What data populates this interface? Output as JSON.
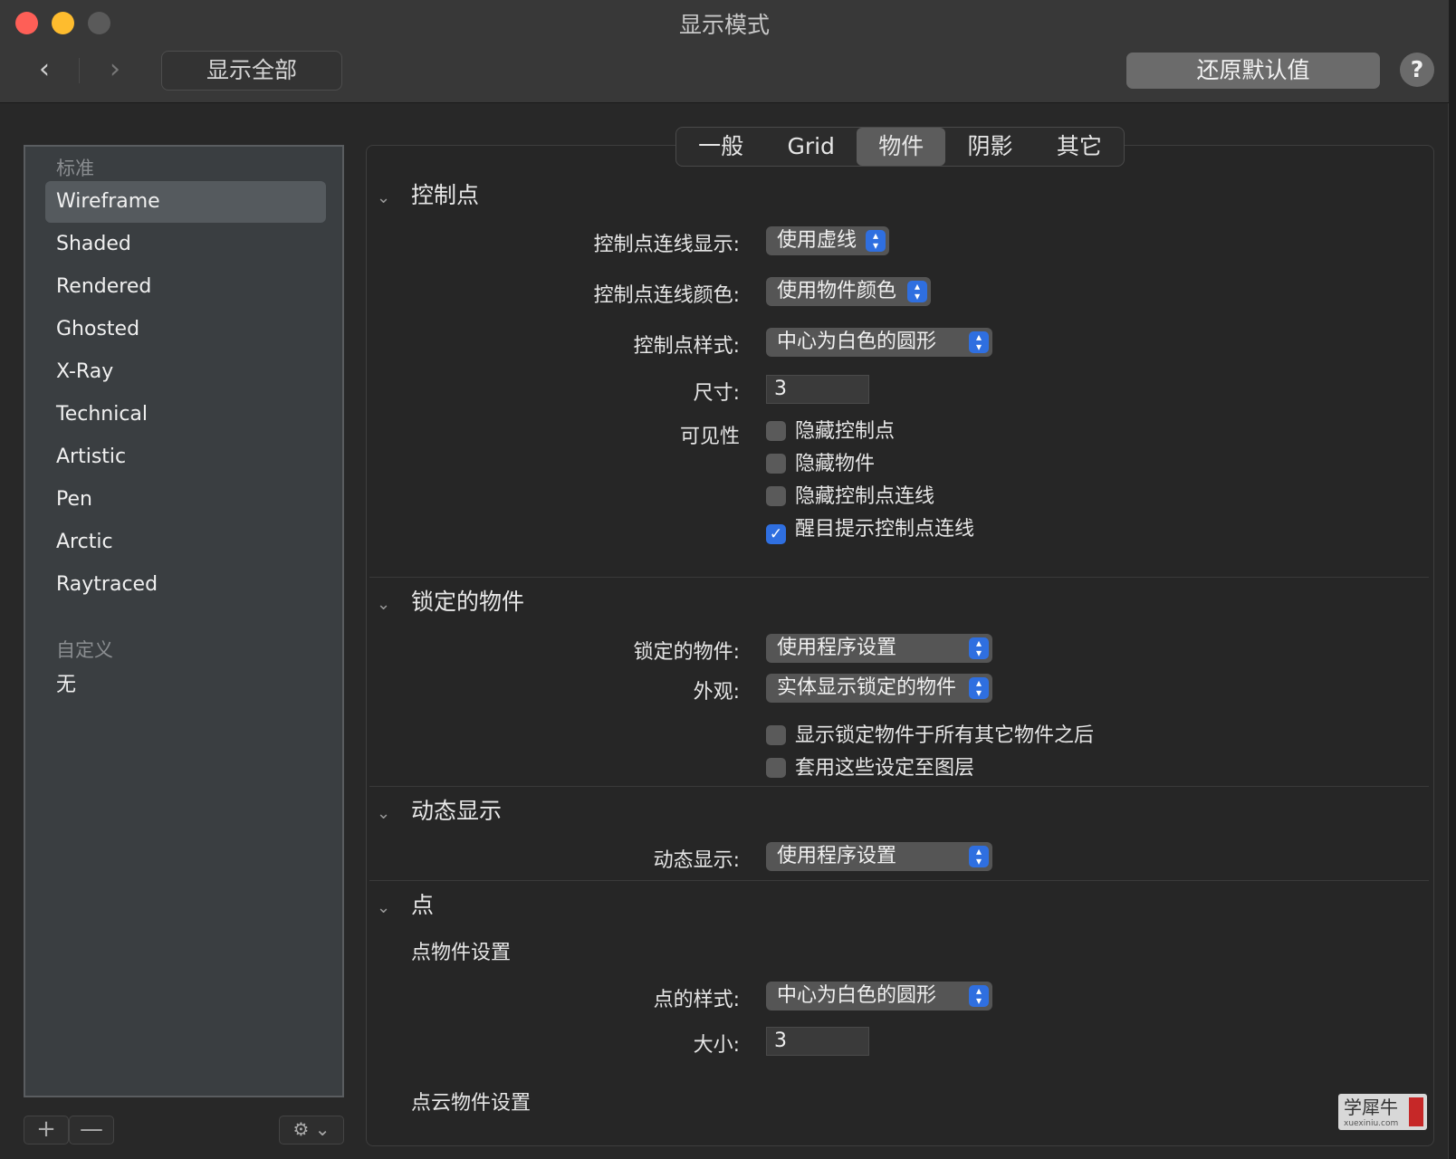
{
  "window": {
    "title": "显示模式",
    "show_all_label": "显示全部",
    "restore_label": "还原默认值",
    "help_label": "?"
  },
  "sidebar": {
    "group_standard": "标准",
    "standard_items": [
      "Wireframe",
      "Shaded",
      "Rendered",
      "Ghosted",
      "X-Ray",
      "Technical",
      "Artistic",
      "Pen",
      "Arctic",
      "Raytraced"
    ],
    "selected": "Wireframe",
    "group_custom": "自定义",
    "custom_items": [
      "无"
    ],
    "add_label": "+",
    "remove_label": "—"
  },
  "tabs": [
    "一般",
    "Grid",
    "物件",
    "阴影",
    "其它"
  ],
  "selected_tab": "物件",
  "control_points": {
    "title": "控制点",
    "line_display_label": "控制点连线显示:",
    "line_display_value": "使用虚线",
    "line_color_label": "控制点连线颜色:",
    "line_color_value": "使用物件颜色",
    "style_label": "控制点样式:",
    "style_value": "中心为白色的圆形",
    "size_label": "尺寸:",
    "size_value": "3",
    "visibility_label": "可见性",
    "checkboxes": [
      {
        "label": "隐藏控制点",
        "checked": false
      },
      {
        "label": "隐藏物件",
        "checked": false
      },
      {
        "label": "隐藏控制点连线",
        "checked": false
      },
      {
        "label": "醒目提示控制点连线",
        "checked": true
      }
    ]
  },
  "locked_objects": {
    "title": "锁定的物件",
    "locked_label": "锁定的物件:",
    "locked_value": "使用程序设置",
    "appearance_label": "外观:",
    "appearance_value": "实体显示锁定的物件",
    "checkboxes": [
      {
        "label": "显示锁定物件于所有其它物件之后",
        "checked": false
      },
      {
        "label": "套用这些设定至图层",
        "checked": false
      }
    ]
  },
  "dynamic_display": {
    "title": "动态显示",
    "label": "动态显示:",
    "value": "使用程序设置"
  },
  "points": {
    "title": "点",
    "point_object_settings": "点物件设置",
    "style_label": "点的样式:",
    "style_value": "中心为白色的圆形",
    "size_label": "大小:",
    "size_value": "3",
    "point_cloud_settings": "点云物件设置"
  },
  "watermark": {
    "text": "学犀牛",
    "url": "xuexiniu.com"
  },
  "colors": {
    "accent": "#2f6fe0",
    "close": "#fe5f57",
    "minimize": "#febc2e"
  }
}
